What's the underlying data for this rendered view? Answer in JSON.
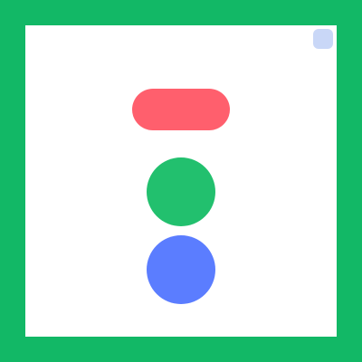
{
  "window": {
    "title": ""
  },
  "colors": {
    "border": "#12b866",
    "background": "#ffffff",
    "pill_button": "#ff5f6d",
    "green_circle": "#22c06e",
    "blue_circle": "#5b7dff",
    "corner_button": "#c9d7f7"
  }
}
